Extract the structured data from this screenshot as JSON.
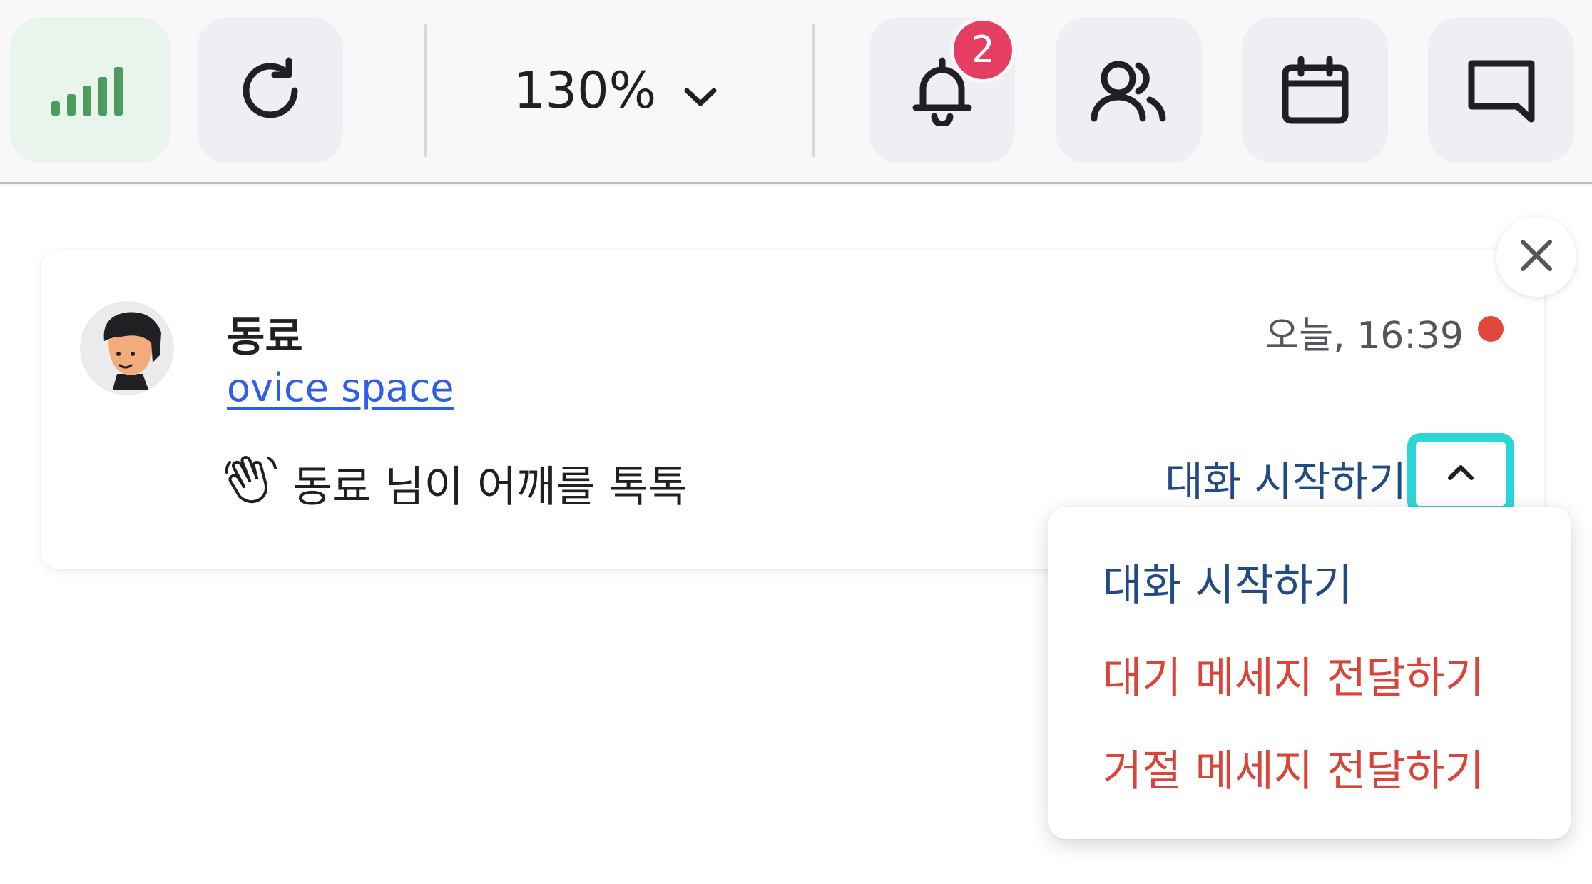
{
  "toolbar": {
    "network_icon": "signal-bars-icon",
    "refresh_icon": "refresh-icon",
    "zoom": {
      "value": "130%",
      "icon": "chevron-down-icon"
    },
    "notifications": {
      "icon": "bell-icon",
      "badge_count": "2"
    },
    "members_icon": "people-icon",
    "calendar_icon": "calendar-icon",
    "chat_icon": "chat-bubble-icon"
  },
  "notification": {
    "sender": "동료",
    "space": "ovice space",
    "time": "오늘, 16:39",
    "unread": true,
    "message": "동료 님이 어깨를 톡톡",
    "message_icon": "waving-hand-icon",
    "primary_action": "대화 시작하기",
    "toggle_icon": "chevron-up-icon",
    "close_icon": "close-icon"
  },
  "menu": {
    "items": [
      {
        "label": "대화 시작하기",
        "color": "#224b84"
      },
      {
        "label": "대기 메세지 전달하기",
        "color": "#d8453a"
      },
      {
        "label": "거절 메세지 전달하기",
        "color": "#d8453a"
      }
    ]
  },
  "colors": {
    "accent_signal": "#4e9b5e",
    "badge": "#e63e63",
    "link": "#2f5ee8",
    "action": "#224b84",
    "danger": "#d8453a",
    "focus_ring": "#2dd6d6",
    "unread_dot": "#e2473b"
  }
}
